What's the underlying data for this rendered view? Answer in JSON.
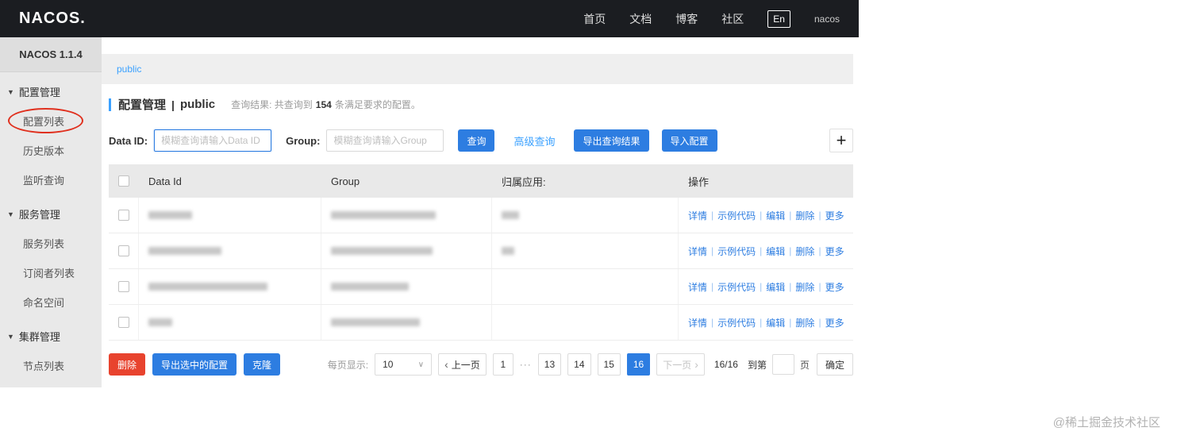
{
  "topbar": {
    "logo": "NACOS.",
    "nav": [
      "首页",
      "文档",
      "博客",
      "社区"
    ],
    "lang_toggle": "En",
    "username": "nacos"
  },
  "sidebar": {
    "version": "NACOS 1.1.4",
    "sections": [
      {
        "label": "配置管理",
        "items": [
          "配置列表",
          "历史版本",
          "监听查询"
        ]
      },
      {
        "label": "服务管理",
        "items": [
          "服务列表",
          "订阅者列表",
          "命名空间"
        ]
      },
      {
        "label": "集群管理",
        "items": [
          "节点列表"
        ]
      }
    ],
    "active_item": "配置列表"
  },
  "namespace_bar": {
    "current": "public"
  },
  "content_header": {
    "title": "配置管理",
    "separator": "|",
    "namespace": "public",
    "result_prefix": "查询结果: 共查询到",
    "result_count": "154",
    "result_suffix": "条满足要求的配置。"
  },
  "filters": {
    "dataid_label": "Data ID:",
    "dataid_placeholder": "模糊查询请输入Data ID",
    "group_label": "Group:",
    "group_placeholder": "模糊查询请输入Group",
    "search_button": "查询",
    "advanced_link": "高级查询",
    "export_button": "导出查询结果",
    "import_button": "导入配置",
    "add_button": "+"
  },
  "table": {
    "headers": {
      "data_id": "Data Id",
      "group": "Group",
      "app": "归属应用:",
      "ops": "操作"
    },
    "actions": [
      "详情",
      "示例代码",
      "编辑",
      "删除",
      "更多"
    ],
    "separator": "|",
    "row_count": 4
  },
  "bulk_actions": {
    "delete": "删除",
    "export_selected": "导出选中的配置",
    "clone": "克隆"
  },
  "pagination": {
    "page_size_label": "每页显示:",
    "page_size": "10",
    "select_chevron": "∨",
    "chevron_left": "‹",
    "chevron_right": "›",
    "prev_label": "上一页",
    "next_label": "下一页",
    "pages": [
      "1",
      "13",
      "14",
      "15",
      "16"
    ],
    "ellipsis": "···",
    "active_page": "16",
    "total_info": "16/16",
    "goto_label": "到第",
    "goto_unit": "页",
    "confirm_button": "确定"
  },
  "watermark": "@稀土掘金技术社区"
}
